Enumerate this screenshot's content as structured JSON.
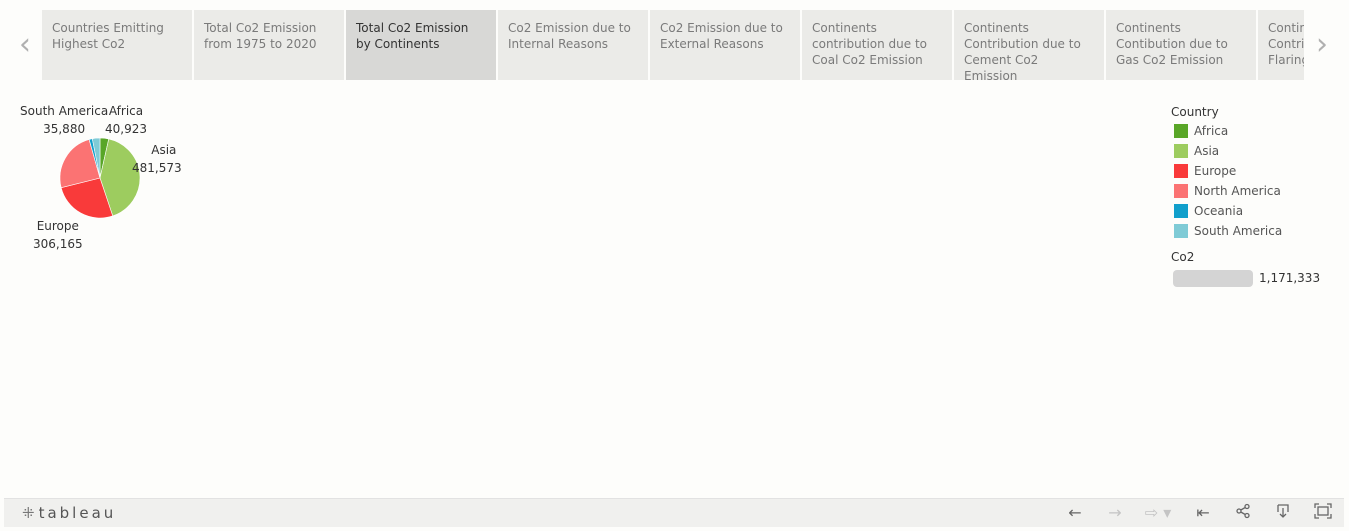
{
  "tabs": [
    {
      "label": "Countries Emitting Highest Co2",
      "active": false
    },
    {
      "label": "Total Co2 Emission from 1975 to 2020",
      "active": false
    },
    {
      "label": "Total Co2 Emission by Continents",
      "active": true
    },
    {
      "label": "Co2 Emission due to Internal Reasons",
      "active": false
    },
    {
      "label": "Co2 Emission due to External Reasons",
      "active": false
    },
    {
      "label": "Continents contribution due to Coal Co2 Emission",
      "active": false
    },
    {
      "label": "Continents Contribution due to Cement Co2 Emission",
      "active": false
    },
    {
      "label": "Continents Contibution due to Gas Co2 Emission",
      "active": false
    },
    {
      "label": "Continents Contribution due to Flaring",
      "active": false
    }
  ],
  "nav": {
    "prev_icon": "chevron-left-icon",
    "next_icon": "chevron-right-icon"
  },
  "chart_data": {
    "type": "pie",
    "categories": [
      "Africa",
      "Asia",
      "Europe",
      "North America",
      "Oceania",
      "South America"
    ],
    "values": [
      40923,
      481573,
      306165,
      null,
      null,
      35880
    ],
    "value_labels": [
      "40,923",
      "481,573",
      "306,165",
      "",
      "",
      "35,880"
    ],
    "colors": {
      "Africa": "#59a627",
      "Asia": "#9dcc5f",
      "Europe": "#f93a3a",
      "North America": "#fb7373",
      "Oceania": "#119fcb",
      "South America": "#7fcbd6"
    },
    "legend_title": "Country",
    "legend_position": "right",
    "size_legend": {
      "title": "Co2",
      "max_label": "1,171,333",
      "max_value": 1171333
    }
  },
  "footer": {
    "logo_text": "tableau",
    "icons": [
      "undo-icon",
      "redo-icon",
      "revert-icon",
      "reset-icon",
      "share-icon",
      "download-icon",
      "fullscreen-icon"
    ]
  }
}
